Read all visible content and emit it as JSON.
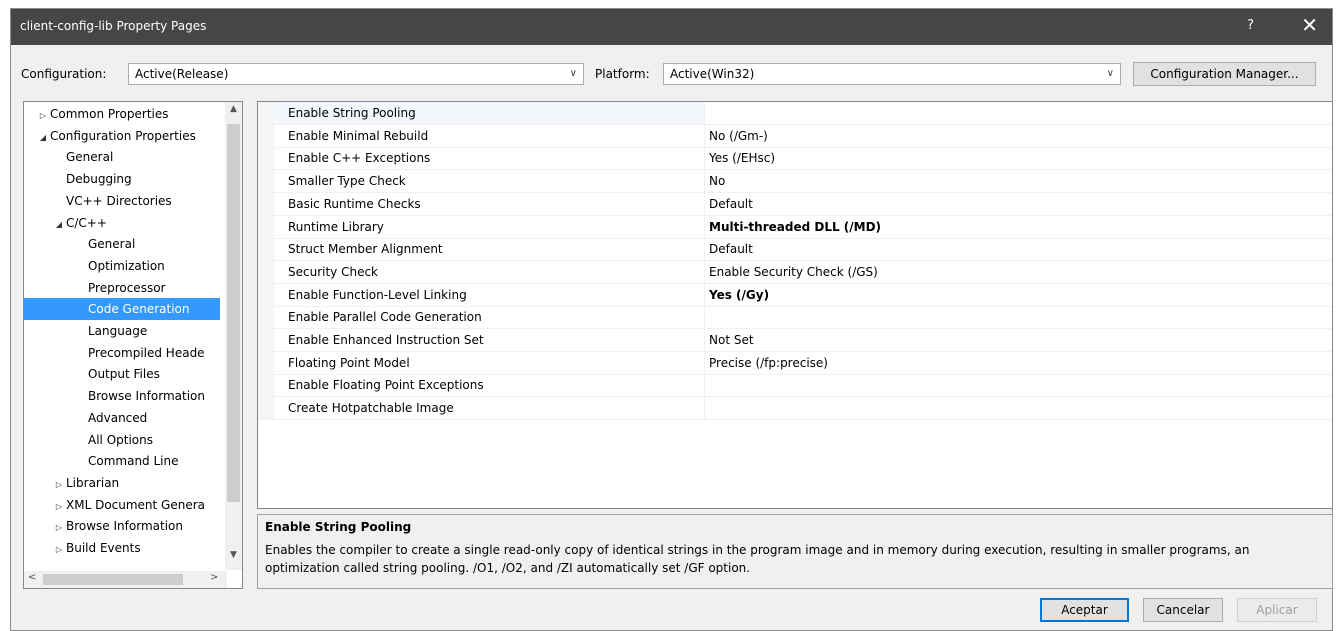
{
  "window": {
    "title": "client-config-lib Property Pages",
    "help_label": "?",
    "close_label": "✕"
  },
  "toolbar": {
    "configuration_label": "Configuration:",
    "configuration_value": "Active(Release)",
    "platform_label": "Platform:",
    "platform_value": "Active(Win32)",
    "config_manager_label": "Configuration Manager..."
  },
  "tree": {
    "items": [
      {
        "label": "Common Properties",
        "level": 0,
        "expander": "▷"
      },
      {
        "label": "Configuration Properties",
        "level": 0,
        "expander": "◢"
      },
      {
        "label": "General",
        "level": 1,
        "expander": ""
      },
      {
        "label": "Debugging",
        "level": 1,
        "expander": ""
      },
      {
        "label": "VC++ Directories",
        "level": 1,
        "expander": ""
      },
      {
        "label": "C/C++",
        "level": 1,
        "expander": "◢"
      },
      {
        "label": "General",
        "level": 2,
        "expander": ""
      },
      {
        "label": "Optimization",
        "level": 2,
        "expander": ""
      },
      {
        "label": "Preprocessor",
        "level": 2,
        "expander": ""
      },
      {
        "label": "Code Generation",
        "level": 2,
        "expander": "",
        "selected": true
      },
      {
        "label": "Language",
        "level": 2,
        "expander": ""
      },
      {
        "label": "Precompiled Heade",
        "level": 2,
        "expander": ""
      },
      {
        "label": "Output Files",
        "level": 2,
        "expander": ""
      },
      {
        "label": "Browse Information",
        "level": 2,
        "expander": ""
      },
      {
        "label": "Advanced",
        "level": 2,
        "expander": ""
      },
      {
        "label": "All Options",
        "level": 2,
        "expander": ""
      },
      {
        "label": "Command Line",
        "level": 2,
        "expander": ""
      },
      {
        "label": "Librarian",
        "level": 1,
        "expander": "▷"
      },
      {
        "label": "XML Document Genera",
        "level": 1,
        "expander": "▷"
      },
      {
        "label": "Browse Information",
        "level": 1,
        "expander": "▷"
      },
      {
        "label": "Build Events",
        "level": 1,
        "expander": "▷"
      }
    ]
  },
  "properties": [
    {
      "name": "Enable String Pooling",
      "value": "",
      "bold": false
    },
    {
      "name": "Enable Minimal Rebuild",
      "value": "No (/Gm-)",
      "bold": false
    },
    {
      "name": "Enable C++ Exceptions",
      "value": "Yes (/EHsc)",
      "bold": false
    },
    {
      "name": "Smaller Type Check",
      "value": "No",
      "bold": false
    },
    {
      "name": "Basic Runtime Checks",
      "value": "Default",
      "bold": false
    },
    {
      "name": "Runtime Library",
      "value": "Multi-threaded DLL (/MD)",
      "bold": true
    },
    {
      "name": "Struct Member Alignment",
      "value": "Default",
      "bold": false
    },
    {
      "name": "Security Check",
      "value": "Enable Security Check (/GS)",
      "bold": false
    },
    {
      "name": "Enable Function-Level Linking",
      "value": "Yes (/Gy)",
      "bold": true
    },
    {
      "name": "Enable Parallel Code Generation",
      "value": "",
      "bold": false
    },
    {
      "name": "Enable Enhanced Instruction Set",
      "value": "Not Set",
      "bold": false
    },
    {
      "name": "Floating Point Model",
      "value": "Precise (/fp:precise)",
      "bold": false
    },
    {
      "name": "Enable Floating Point Exceptions",
      "value": "",
      "bold": false
    },
    {
      "name": "Create Hotpatchable Image",
      "value": "",
      "bold": false
    }
  ],
  "description": {
    "title": "Enable String Pooling",
    "text": "Enables the compiler to create a single read-only copy of identical strings in the program image and in memory during execution, resulting in smaller programs, an optimization called string pooling. /O1, /O2, and /ZI  automatically set /GF option."
  },
  "buttons": {
    "ok": "Aceptar",
    "cancel": "Cancelar",
    "apply": "Aplicar"
  },
  "icons": {
    "dropdown": "chevron-down-icon",
    "scroll_up": "scroll-up-arrow-icon",
    "scroll_down": "scroll-down-arrow-icon",
    "scroll_left": "scroll-left-arrow-icon",
    "scroll_right": "scroll-right-arrow-icon"
  },
  "colors": {
    "titlebar": "#464646",
    "selection": "#3399ff",
    "primary_border": "#0078d7"
  }
}
